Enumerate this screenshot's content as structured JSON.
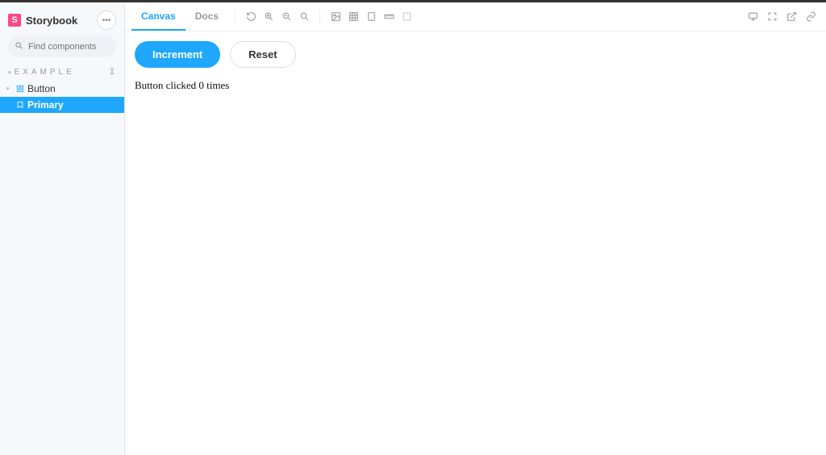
{
  "brand": {
    "logo_letter": "S",
    "title": "Storybook"
  },
  "menu_ellipsis": "•••",
  "search": {
    "placeholder": "Find components",
    "shortcut": "/"
  },
  "sidebar": {
    "section": "EXAMPLE",
    "tree": {
      "component_label": "Button",
      "story_label": "Primary"
    }
  },
  "tabs": {
    "canvas": "Canvas",
    "docs": "Docs"
  },
  "preview": {
    "increment_label": "Increment",
    "reset_label": "Reset",
    "click_text": "Button clicked 0 times"
  }
}
